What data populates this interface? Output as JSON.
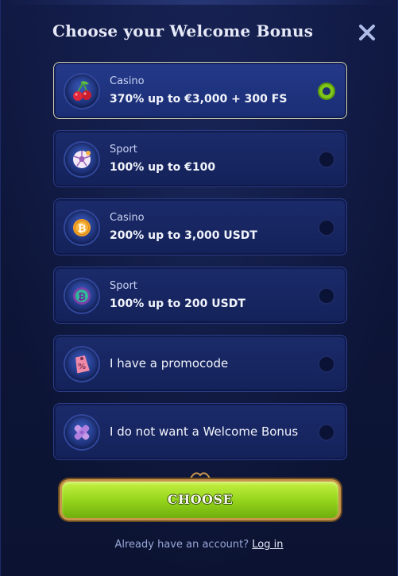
{
  "dialog": {
    "title": "Choose your Welcome Bonus"
  },
  "options": [
    {
      "category": "Casino",
      "title": "370% up to €3,000 + 300 FS",
      "icon": "cherry-icon",
      "selected": true
    },
    {
      "category": "Sport",
      "title": "100% up to €100",
      "icon": "soccer-ball-icon",
      "selected": false
    },
    {
      "category": "Casino",
      "title": "200% up to 3,000 USDT",
      "icon": "bitcoin-coin-icon",
      "selected": false
    },
    {
      "category": "Sport",
      "title": "100% up to 200 USDT",
      "icon": "crypto-ball-icon",
      "selected": false
    },
    {
      "title": "I have a promocode",
      "icon": "percent-tag-icon",
      "selected": false
    },
    {
      "title": "I do not want a Welcome Bonus",
      "icon": "cross-bandage-icon",
      "selected": false
    }
  ],
  "actions": {
    "choose_label": "CHOOSE"
  },
  "footer": {
    "prompt": "Already have an account?",
    "login_label": "Log in"
  },
  "colors": {
    "background": "#0d1538",
    "accent_green": "#96d61c",
    "border_gold": "#c8964a"
  }
}
